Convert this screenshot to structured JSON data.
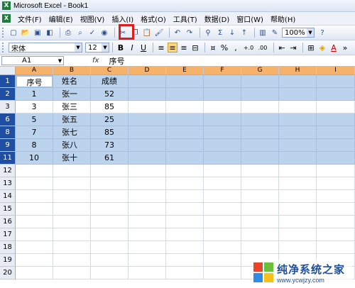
{
  "window": {
    "title": "Microsoft Excel - Book1",
    "app_icon": "excel-icon"
  },
  "menu": {
    "items": [
      {
        "label": "文件(F)"
      },
      {
        "label": "编辑(E)"
      },
      {
        "label": "视图(V)"
      },
      {
        "label": "插入(I)"
      },
      {
        "label": "格式(O)"
      },
      {
        "label": "工具(T)"
      },
      {
        "label": "数据(D)"
      },
      {
        "label": "窗口(W)"
      },
      {
        "label": "帮助(H)"
      }
    ]
  },
  "toolbar": {
    "zoom": "100%",
    "highlighted_button": "paste-icon"
  },
  "format_toolbar": {
    "font_name": "宋体",
    "font_size": "12",
    "bold": "B",
    "italic": "I",
    "underline": "U",
    "percent": "%",
    "comma": ",",
    "increase_decimal": "+.0",
    "decrease_decimal": ".00"
  },
  "formula_bar": {
    "name_box": "A1",
    "fx": "fx",
    "content": "序号"
  },
  "columns": [
    "A",
    "B",
    "C",
    "D",
    "E",
    "F",
    "G",
    "H",
    "I"
  ],
  "rows": [
    {
      "num": "1",
      "selected": true,
      "cells": [
        "序号",
        "姓名",
        "成绩"
      ]
    },
    {
      "num": "2",
      "selected": true,
      "cells": [
        "1",
        "张一",
        "52"
      ]
    },
    {
      "num": "3",
      "selected": false,
      "cells": [
        "3",
        "张三",
        "85"
      ]
    },
    {
      "num": "6",
      "selected": true,
      "cells": [
        "5",
        "张五",
        "25"
      ]
    },
    {
      "num": "8",
      "selected": true,
      "cells": [
        "7",
        "张七",
        "85"
      ]
    },
    {
      "num": "9",
      "selected": true,
      "cells": [
        "8",
        "张八",
        "73"
      ]
    },
    {
      "num": "11",
      "selected": true,
      "cells": [
        "10",
        "张十",
        "61"
      ]
    },
    {
      "num": "12",
      "selected": false,
      "cells": [
        "",
        "",
        ""
      ]
    },
    {
      "num": "13",
      "selected": false,
      "cells": [
        "",
        "",
        ""
      ]
    },
    {
      "num": "14",
      "selected": false,
      "cells": [
        "",
        "",
        ""
      ]
    },
    {
      "num": "15",
      "selected": false,
      "cells": [
        "",
        "",
        ""
      ]
    },
    {
      "num": "16",
      "selected": false,
      "cells": [
        "",
        "",
        ""
      ]
    },
    {
      "num": "17",
      "selected": false,
      "cells": [
        "",
        "",
        ""
      ]
    },
    {
      "num": "18",
      "selected": false,
      "cells": [
        "",
        "",
        ""
      ]
    },
    {
      "num": "19",
      "selected": false,
      "cells": [
        "",
        "",
        ""
      ]
    },
    {
      "num": "20",
      "selected": false,
      "cells": [
        "",
        "",
        ""
      ]
    }
  ],
  "watermark": {
    "title": "纯净系统之家",
    "url": "www.ycwjzy.com"
  },
  "colors": {
    "selection": "#bcd3ee",
    "header_selected": "#1f4fa3",
    "column_header": "#f6b26b",
    "highlight": "#e01d1d"
  }
}
